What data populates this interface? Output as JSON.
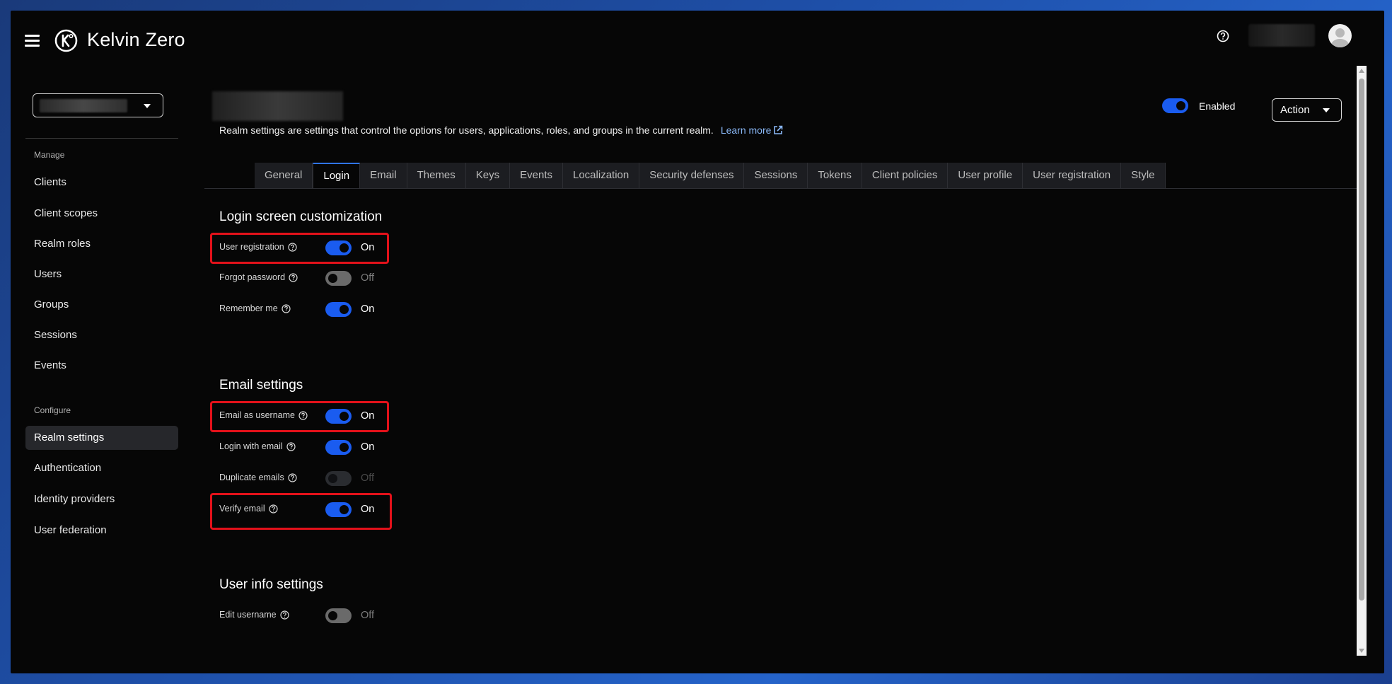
{
  "header": {
    "brand": "Kelvin Zero",
    "icons": {
      "menu": "hamburger-icon",
      "logo": "kelvin-zero-logo-icon",
      "help": "question-circle-icon",
      "avatar": "user-avatar-icon"
    }
  },
  "sidebar": {
    "manage_label": "Manage",
    "configure_label": "Configure",
    "manage_items": [
      {
        "label": "Clients"
      },
      {
        "label": "Client scopes"
      },
      {
        "label": "Realm roles"
      },
      {
        "label": "Users"
      },
      {
        "label": "Groups"
      },
      {
        "label": "Sessions"
      },
      {
        "label": "Events"
      }
    ],
    "configure_items": [
      {
        "label": "Realm settings",
        "active": true
      },
      {
        "label": "Authentication"
      },
      {
        "label": "Identity providers"
      },
      {
        "label": "User federation"
      }
    ]
  },
  "main": {
    "description": "Realm settings are settings that control the options for users, applications, roles, and groups in the current realm.",
    "learn_more": "Learn more",
    "enabled_label": "Enabled",
    "action_label": "Action",
    "tabs": [
      {
        "label": "General"
      },
      {
        "label": "Login",
        "active": true
      },
      {
        "label": "Email"
      },
      {
        "label": "Themes"
      },
      {
        "label": "Keys"
      },
      {
        "label": "Events"
      },
      {
        "label": "Localization"
      },
      {
        "label": "Security defenses"
      },
      {
        "label": "Sessions"
      },
      {
        "label": "Tokens"
      },
      {
        "label": "Client policies"
      },
      {
        "label": "User profile"
      },
      {
        "label": "User registration"
      },
      {
        "label": "Style"
      }
    ],
    "sections": {
      "login": {
        "title": "Login screen customization",
        "rows": [
          {
            "label": "User registration",
            "state": "On",
            "on": true
          },
          {
            "label": "Forgot password",
            "state": "Off",
            "on": false
          },
          {
            "label": "Remember me",
            "state": "On",
            "on": true
          }
        ]
      },
      "email": {
        "title": "Email settings",
        "rows": [
          {
            "label": "Email as username",
            "state": "On",
            "on": true
          },
          {
            "label": "Login with email",
            "state": "On",
            "on": true
          },
          {
            "label": "Duplicate emails",
            "state": "Off",
            "on": false,
            "disabled": true
          },
          {
            "label": "Verify email",
            "state": "On",
            "on": true
          }
        ]
      },
      "userinfo": {
        "title": "User info settings",
        "rows": [
          {
            "label": "Edit username",
            "state": "Off",
            "on": false
          }
        ]
      }
    }
  },
  "colors": {
    "accent": "#1a5cf0",
    "highlight": "#e3111a",
    "background": "#060606",
    "link": "#8ab8f7"
  }
}
